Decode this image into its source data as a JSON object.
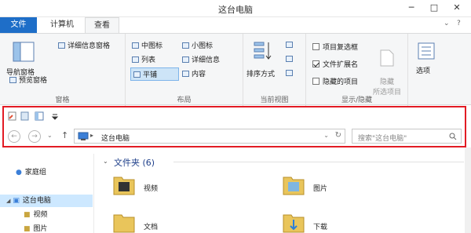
{
  "window": {
    "title": "这台电脑",
    "controls": {
      "minimize": "─",
      "maximize": "□",
      "close": "✕"
    }
  },
  "ribbon_tabs": [
    {
      "label": "文件",
      "active": false
    },
    {
      "label": "计算机",
      "active": false
    },
    {
      "label": "查看",
      "active": true
    }
  ],
  "ribbon_controls": {
    "collapse": "⌄",
    "help": "?"
  },
  "ribbon": {
    "panes_group": {
      "label": "窗格",
      "nav_pane": "导航窗格",
      "preview_pane": "预览窗格",
      "details_pane": "详细信息窗格"
    },
    "layout_group": {
      "label": "布局",
      "options": [
        "中图标",
        "小图标",
        "列表",
        "详细信息",
        "平铺",
        "内容"
      ],
      "selected": "平铺"
    },
    "current_view_group": {
      "label": "当前视图",
      "sort_by": "排序方式"
    },
    "show_hide_group": {
      "label": "显示/隐藏",
      "item_checkboxes": {
        "label": "项目复选框",
        "checked": false
      },
      "file_extensions": {
        "label": "文件扩展名",
        "checked": true
      },
      "hidden_items": {
        "label": "隐藏的项目",
        "checked": false
      },
      "hide_selected": {
        "label": "隐藏\n所选项目"
      }
    },
    "options": {
      "label": "选项"
    }
  },
  "address_bar": {
    "path": "这台电脑",
    "search_placeholder": "搜索\"这台电脑\""
  },
  "nav_pane": {
    "items": [
      {
        "label": "家庭组",
        "level": 0,
        "selected": false
      },
      {
        "label": "这台电脑",
        "level": 0,
        "selected": true
      },
      {
        "label": "视频",
        "level": 1,
        "selected": false
      },
      {
        "label": "图片",
        "level": 1,
        "selected": false
      }
    ]
  },
  "content": {
    "section_header": "文件夹 (6)",
    "folders": [
      "视频",
      "图片",
      "文档",
      "下载"
    ]
  },
  "colors": {
    "accent": "#1e6ec8",
    "highlight_border": "#e21b24",
    "selection": "#cde8ff"
  }
}
